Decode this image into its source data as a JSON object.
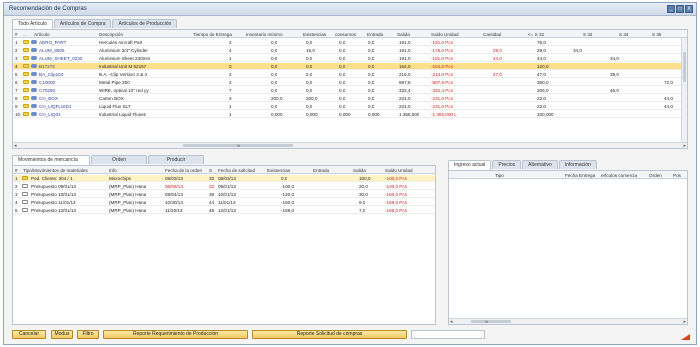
{
  "window": {
    "title": "Recomendación de Compras",
    "buttons": [
      "_",
      "□",
      "X"
    ]
  },
  "top_tabs": [
    "Todo Artículo",
    "Artículos de Compra",
    "Artículos de Producción"
  ],
  "top_grid": {
    "headers": [
      "#",
      "...",
      "Artículo",
      "Descripción",
      "Tiempo de Entrega",
      "Inventario mínimo",
      "Existencias",
      "consumos",
      "Entrada",
      "Salida",
      "Saldo Unidad",
      "Cantidad",
      "<= S 32",
      "S 33",
      "S 34",
      "S 35"
    ],
    "rows": [
      {
        "n": "1",
        "item": "AERO_PART",
        "desc": "Hercules Aircraft Part",
        "lead": "2",
        "min": "0,0",
        "stock": "0,0",
        "cons": "0,0",
        "in": "0,0",
        "out": "191,0",
        "bal": "-191,0 Pcs",
        "qty": "",
        "s32": "76,0",
        "s33": "",
        "s34": "",
        "s35": ""
      },
      {
        "n": "2",
        "item": "ALUM_8505",
        "desc": "Aluminium 3/4\" Cylinder",
        "lead": "4",
        "min": "0,0",
        "stock": "15,0",
        "cons": "0,0",
        "in": "0,0",
        "out": "191,0",
        "bal": "-176,0 Pcs",
        "qty": "29,0",
        "s32": "29,0",
        "s33": "34,0",
        "s34": "",
        "s35": ""
      },
      {
        "n": "3",
        "item": "ALUM_SHEET_0230",
        "desc": "Aluminium Sheet 230mm",
        "lead": "1",
        "min": "0,0",
        "stock": "0,0",
        "cons": "0,0",
        "in": "0,0",
        "out": "191,0",
        "bal": "-191,0 Pcs",
        "qty": "44,0",
        "s32": "44,0",
        "s33": "",
        "s34": "34,0",
        "s35": ""
      },
      {
        "n": "4",
        "item": "B17272",
        "desc": "Industrial Unit M 62157",
        "lead": "0",
        "min": "0,0",
        "stock": "0,0",
        "cons": "0,0",
        "in": "0,0",
        "out": "164,0",
        "bal": "-164,0 Pcs",
        "qty": "",
        "s32": "120,0",
        "s33": "",
        "s34": "",
        "s35": ""
      },
      {
        "n": "5",
        "item": "BA_Clip104",
        "desc": "B.A. -Clip Version 3 & 4",
        "lead": "2",
        "min": "0,0",
        "stock": "2,0",
        "cons": "0,0",
        "in": "0,0",
        "out": "216,0",
        "bal": "-214,0 Pcs",
        "qty": "47,0",
        "s32": "47,0",
        "s33": "",
        "s34": "39,0",
        "s35": ""
      },
      {
        "n": "6",
        "item": "C10000",
        "desc": "Metal Pipe 250",
        "lead": "2",
        "min": "0,0",
        "stock": "0,0",
        "cons": "0,0",
        "in": "0,0",
        "out": "597,6",
        "bal": "-597,6 Pcs",
        "qty": "",
        "s32": "360,0",
        "s33": "",
        "s34": "",
        "s35": "72,0"
      },
      {
        "n": "7",
        "item": "C70250",
        "desc": "WIRE, optical 10\" red yy",
        "lead": "7",
        "min": "0,0",
        "stock": "0,0",
        "cons": "0,0",
        "in": "0,0",
        "out": "332,4",
        "bal": "-332,4 Pcs",
        "qty": "",
        "s32": "206,0",
        "s33": "",
        "s34": "46,0",
        "s35": ""
      },
      {
        "n": "8",
        "item": "CH_BOX",
        "desc": "Carton BOX",
        "lead": "3",
        "min": "200,0",
        "stock": "200,0",
        "cons": "0,0",
        "in": "0,0",
        "out": "231,0",
        "bal": "-231,0 Pcs",
        "qty": "",
        "s32": "22,0",
        "s33": "",
        "s34": "",
        "s35": "44,0"
      },
      {
        "n": "9",
        "item": "CH_LIQFLUID1",
        "desc": "Liquid Flux SLT",
        "lead": "1",
        "min": "0,0",
        "stock": "0,0",
        "cons": "0,0",
        "in": "0,0",
        "out": "231,0",
        "bal": "-231,0 Pcs",
        "qty": "",
        "s32": "22,0",
        "s33": "",
        "s34": "",
        "s35": "44,0"
      },
      {
        "n": "10",
        "item": "CH_LIQ01",
        "desc": "Industrial Liquid Fluxes",
        "lead": "1",
        "min": "0,000",
        "stock": "0,000",
        "cons": "0,000",
        "in": "0,000",
        "out": "1.355,000",
        "bal": "-1.355,000 L",
        "qty": "",
        "s32": "330,000",
        "s33": "",
        "s34": "",
        "s35": ""
      }
    ]
  },
  "bottom_left_tabs": [
    "Movimientos de mercancía",
    "Orden",
    "Producir"
  ],
  "bottom_grid": {
    "headers": [
      "#",
      "Tipo/Movimientos de materiales",
      "Info",
      "Fecha de la orden",
      "S",
      "Fecha de solicitud",
      "Existencias",
      "Entrada",
      "Salida",
      "Saldo Unidad"
    ],
    "rows": [
      {
        "n": "1",
        "type": "Ped. Cliente: 304 / 1",
        "info": "Microchips",
        "odate": "08/03/13",
        "s": "33",
        "rdate": "08/03/13",
        "stock": "0,0",
        "in": "",
        "out": "100,0",
        "bal": "-100,0 Pcs",
        "sel": true
      },
      {
        "n": "2",
        "type": "Presupuesto 09/01/13",
        "info": "(MRP_Plan) Hana",
        "odate": "06/06/13",
        "s": "32",
        "rdate": "09/01/13",
        "stock": "-100,0",
        "in": "",
        "out": "20,0",
        "bal": "-120,0 Pcs",
        "sel": false
      },
      {
        "n": "3",
        "type": "Presupuesto 10/01/13",
        "info": "(MRP_Plan) Hana",
        "odate": "09/04/13",
        "s": "39",
        "rdate": "10/01/13",
        "stock": "-120,0",
        "in": "",
        "out": "30,0",
        "bal": "-150,0 Pcs",
        "sel": false
      },
      {
        "n": "4",
        "type": "Presupuesto 11/01/13",
        "info": "(MRP_Plan) Hana",
        "odate": "10/30/13",
        "s": "44",
        "rdate": "11/01/13",
        "stock": "-150,0",
        "in": "",
        "out": "9,0",
        "bal": "-159,0 Pcs",
        "sel": false
      },
      {
        "n": "5",
        "type": "Presupuesto 12/01/13",
        "info": "(MRP_Plan) Hana",
        "odate": "11/20/13",
        "s": "48",
        "rdate": "12/01/13",
        "stock": "-159,0",
        "in": "",
        "out": "7,0",
        "bal": "-166,0 Pcs",
        "sel": false
      }
    ]
  },
  "bottom_right_tabs": [
    "Ingreso actual",
    "Precios",
    "Alternativo",
    "Información"
  ],
  "right_grid": {
    "headers": [
      "Tipo",
      "Fecha Entrega",
      "erÍculos comercia",
      "Orden",
      "Pos"
    ]
  },
  "footer": {
    "cancel": "Cancelar",
    "modus": "Modus",
    "filter": "Filtro",
    "report_production": "Reporte Requerimiento de Producción",
    "report_purchase": "Reporte Solicitud de compras"
  },
  "colors": {
    "accent": "#f3c963",
    "selected_row": "#ffe08a",
    "negative": "#d02020",
    "title_bar": "#cfd9e8"
  },
  "scroll_marker": "III"
}
